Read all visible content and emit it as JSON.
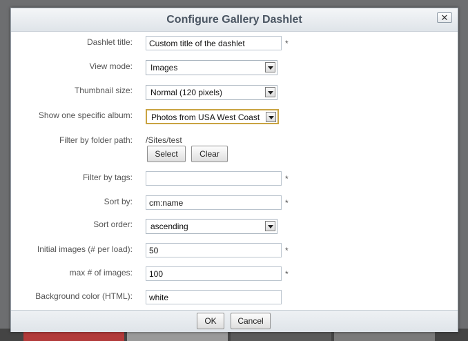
{
  "dialog": {
    "title": "Configure Gallery Dashlet",
    "close_glyph": "✕"
  },
  "form": {
    "dashlet_title": {
      "label": "Dashlet title:",
      "value": "Custom title of the dashlet"
    },
    "view_mode": {
      "label": "View mode:",
      "selected": "Images"
    },
    "thumbnail_size": {
      "label": "Thumbnail size:",
      "selected": "Normal (120 pixels)"
    },
    "specific_album": {
      "label": "Show one specific album:",
      "selected": "Photos from USA West Coast"
    },
    "folder_path": {
      "label": "Filter by folder path:",
      "value": "/Sites/test",
      "select_label": "Select",
      "clear_label": "Clear"
    },
    "tags": {
      "label": "Filter by tags:",
      "value": ""
    },
    "sort_by": {
      "label": "Sort by:",
      "value": "cm:name"
    },
    "sort_order": {
      "label": "Sort order:",
      "selected": "ascending"
    },
    "initial_images": {
      "label": "Initial images (# per load):",
      "value": "50"
    },
    "max_images": {
      "label": "max # of images:",
      "value": "100"
    },
    "bg_color": {
      "label": "Background color (HTML):",
      "value": "white"
    },
    "required_marker": "*"
  },
  "footer": {
    "ok_label": "OK",
    "cancel_label": "Cancel"
  }
}
